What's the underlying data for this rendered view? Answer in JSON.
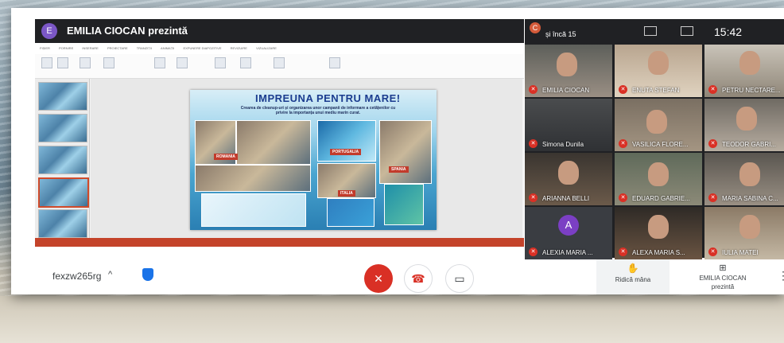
{
  "presenting": {
    "avatar_letter": "E",
    "title": "EMILIA CIOCAN prezintă"
  },
  "ppt": {
    "tabs": [
      "FIȘIER",
      "PORNIRE",
      "INSERARE",
      "PROIECTARE",
      "TRANZIȚII",
      "ANIMAȚII",
      "EXPUNERE DIAPOZITIVE",
      "REVIZUIRE",
      "VIZUALIZARE"
    ],
    "slide_title": "IMPREUNA PENTRU MARE!",
    "slide_subtitle": "Crearea de cleanup-uri și organizarea unor campanii de informare a cetățenilor cu privire la importanța unui mediu marin curat.",
    "tags": {
      "romania": "ROMANIA",
      "portugalia": "PORTUGALIA",
      "spania": "SPANIA",
      "italia": "ITALIA"
    }
  },
  "grid": {
    "top_avatar": "C",
    "top_sub": "și încă 15",
    "time": "15:42",
    "tiles": [
      {
        "name": "EMILIA CIOCAN",
        "active": true
      },
      {
        "name": "ENUTA STEFAN"
      },
      {
        "name": "PETRU NECTARE..."
      },
      {
        "name": "Simona Dunila"
      },
      {
        "name": "VASILICA FLORE..."
      },
      {
        "name": "TEODOR GABRI..."
      },
      {
        "name": "ARIANNA BELLI"
      },
      {
        "name": "EDUARD GABRIE..."
      },
      {
        "name": "MARIA SABINA C..."
      },
      {
        "name": "ALEXIA MARIA ...",
        "avatar": "A"
      },
      {
        "name": "ALEXA MARIA S..."
      },
      {
        "name": "IULIA MATEI"
      }
    ]
  },
  "controls": {
    "meeting_code": "fexzw265rg",
    "raise_hand": "Ridică mâna",
    "presenter_line1": "EMILIA CIOCAN",
    "presenter_line2": "prezintă"
  }
}
